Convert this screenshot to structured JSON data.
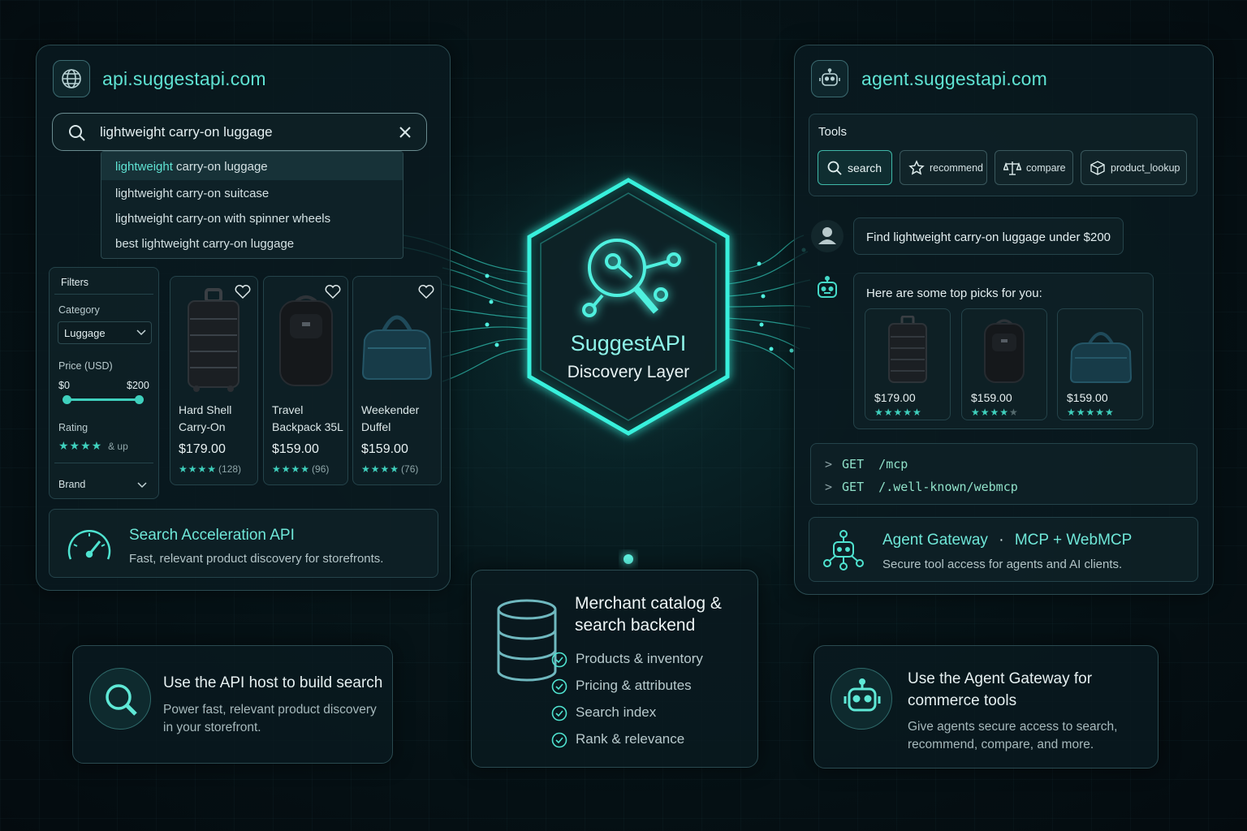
{
  "left_panel": {
    "host": "api.suggestapi.com",
    "search": {
      "value": "lightweight carry-on luggage",
      "suggestions": [
        {
          "highlight": "lightweight",
          "rest": " carry-on luggage"
        },
        {
          "text": "lightweight carry-on suitcase"
        },
        {
          "text": "lightweight carry-on with spinner wheels"
        },
        {
          "text": "best lightweight carry-on luggage"
        }
      ]
    },
    "filters": {
      "title": "Filters",
      "category_label": "Category",
      "category_value": "Luggage",
      "price_label": "Price (USD)",
      "price_min": "$0",
      "price_max": "$200",
      "rating_label": "Rating",
      "rating_stars": "★★★★",
      "rating_suffix": "& up",
      "brand_label": "Brand"
    },
    "products": [
      {
        "name_line1": "Hard Shell",
        "name_line2": "Carry-On",
        "price": "$179.00",
        "stars": "★★★★",
        "count": "(128)"
      },
      {
        "name_line1": "Travel",
        "name_line2": "Backpack 35L",
        "price": "$159.00",
        "stars": "★★★★",
        "count": "(96)"
      },
      {
        "name_line1": "Weekender",
        "name_line2": "Duffel",
        "price": "$159.00",
        "stars": "★★★★",
        "count": "(76)"
      }
    ],
    "feature": {
      "title": "Search Acceleration API",
      "subtitle": "Fast, relevant product discovery for storefronts."
    }
  },
  "hub": {
    "title": "SuggestAPI",
    "subtitle": "Discovery Layer"
  },
  "right_panel": {
    "host": "agent.suggestapi.com",
    "tools_label": "Tools",
    "tools": [
      "search",
      "recommend",
      "compare",
      "product_lookup"
    ],
    "user_message": "Find lightweight carry-on luggage under $200",
    "agent_message": "Here are some top picks for you:",
    "picks": [
      {
        "price": "$179.00",
        "stars": "★★★★★",
        "empty": ""
      },
      {
        "price": "$159.00",
        "stars": "★★★★",
        "empty": "★"
      },
      {
        "price": "$159.00",
        "stars": "★★★★★",
        "empty": ""
      }
    ],
    "code": [
      {
        "prompt": ">",
        "text": "GET  /mcp"
      },
      {
        "prompt": ">",
        "text": "GET  /.well-known/webmcp"
      }
    ],
    "gateway": {
      "title": "Agent Gateway",
      "sep": "·",
      "title2": "MCP + WebMCP",
      "subtitle": "Secure tool access for agents and AI clients."
    }
  },
  "bottom": {
    "left_card": {
      "title": "Use the API host to build search",
      "line1": "Power fast, relevant product discovery",
      "line2": "in your storefront."
    },
    "center_card": {
      "title_line1": "Merchant catalog &",
      "title_line2": "search backend",
      "items": [
        "Products & inventory",
        "Pricing & attributes",
        "Search index",
        "Rank & relevance"
      ]
    },
    "right_card": {
      "title_line1": "Use the Agent Gateway for",
      "title_line2": "commerce tools",
      "line1": "Give agents secure access to search,",
      "line2": "recommend, compare, and more."
    }
  },
  "colors": {
    "accent": "#5fe3d3",
    "glow": "#2fe6d0",
    "background": "#061418"
  }
}
